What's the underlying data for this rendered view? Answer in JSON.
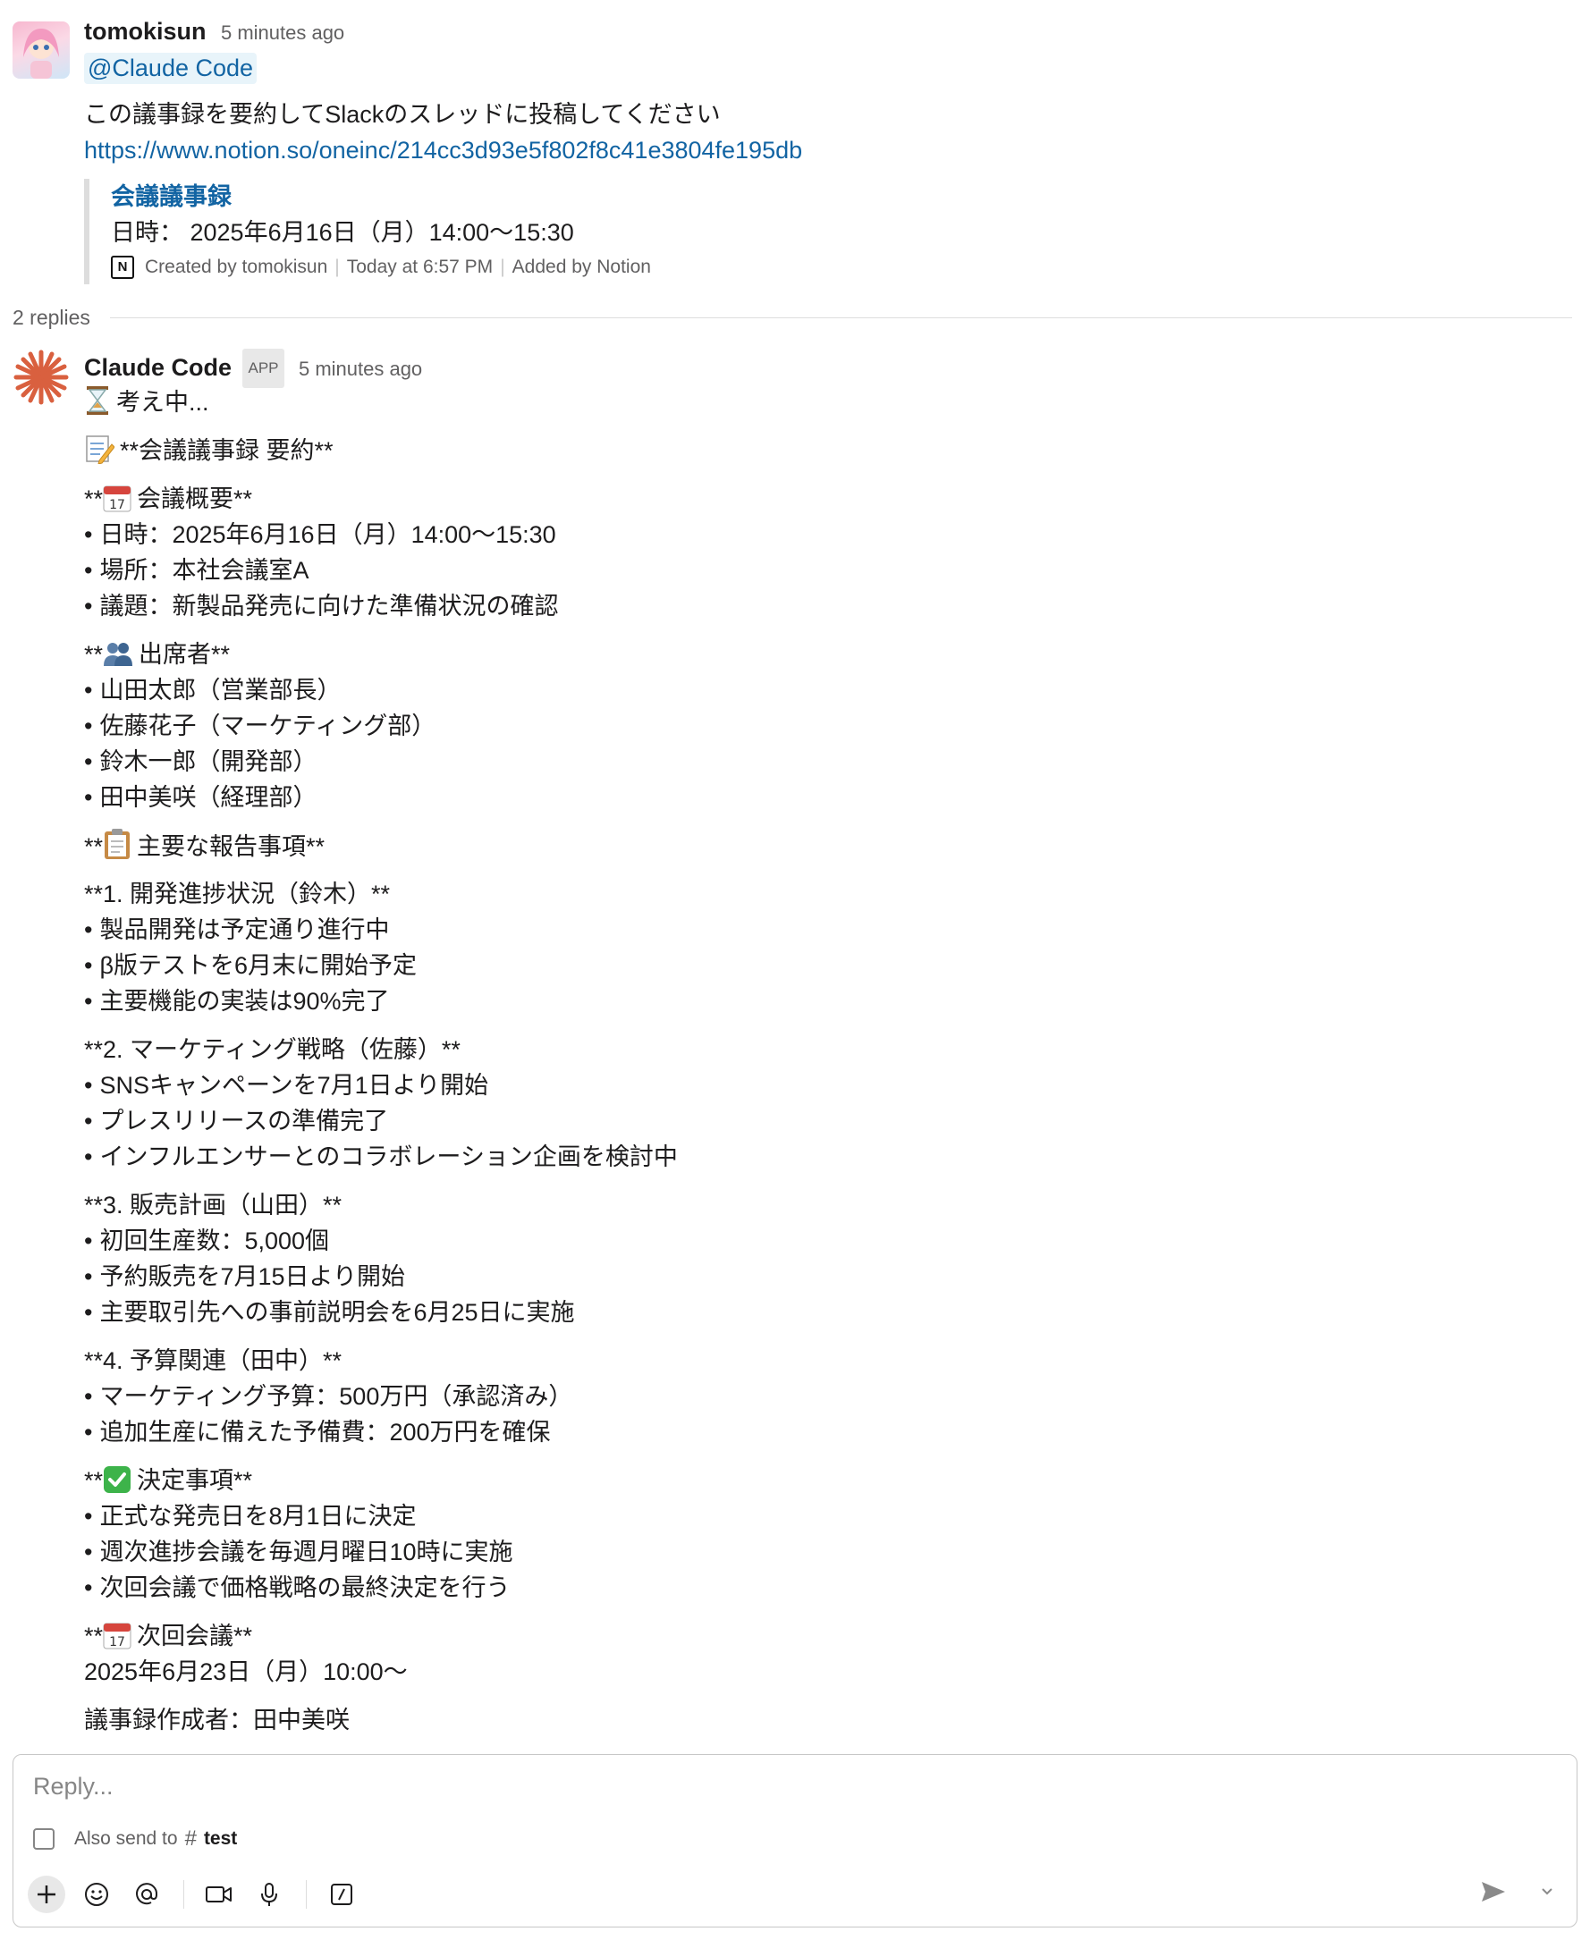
{
  "parent": {
    "author": "tomokisun",
    "time": "5 minutes ago",
    "mention": "@Claude Code",
    "text": "この議事録を要約してSlackのスレッドに投稿してください",
    "link": "https://www.notion.so/oneinc/214cc3d93e5f802f8c41e3804fe195db",
    "unfurl": {
      "title": "会議議事録",
      "desc": "日時： 2025年6月16日（月）14:00〜15:30",
      "created": "Created by tomokisun",
      "when": "Today at 6:57 PM",
      "added": "Added by Notion"
    }
  },
  "replies_label": "2 replies",
  "reply": {
    "author": "Claude Code",
    "badge": "APP",
    "time": "5 minutes ago",
    "thinking": "考え中...",
    "summary_title": "**会議議事録 要約**",
    "overview_heading_pre": "**",
    "overview_heading": "会議概要**",
    "overview": [
      "日時：2025年6月16日（月）14:00〜15:30",
      "場所：本社会議室A",
      "議題：新製品発売に向けた準備状況の確認"
    ],
    "attendees_heading_pre": "**",
    "attendees_heading": "出席者**",
    "attendees": [
      "山田太郎（営業部長）",
      "佐藤花子（マーケティング部）",
      "鈴木一郎（開発部）",
      "田中美咲（経理部）"
    ],
    "reports_heading_pre": "**",
    "reports_heading": "主要な報告事項**",
    "sections": [
      {
        "title": "**1. 開発進捗状況（鈴木）**",
        "items": [
          "製品開発は予定通り進行中",
          "β版テストを6月末に開始予定",
          "主要機能の実装は90%完了"
        ]
      },
      {
        "title": "**2. マーケティング戦略（佐藤）**",
        "items": [
          "SNSキャンペーンを7月1日より開始",
          "プレスリリースの準備完了",
          "インフルエンサーとのコラボレーション企画を検討中"
        ]
      },
      {
        "title": "**3. 販売計画（山田）**",
        "items": [
          "初回生産数：5,000個",
          "予約販売を7月15日より開始",
          "主要取引先への事前説明会を6月25日に実施"
        ]
      },
      {
        "title": "**4. 予算関連（田中）**",
        "items": [
          "マーケティング予算：500万円（承認済み）",
          "追加生産に備えた予備費：200万円を確保"
        ]
      }
    ],
    "decisions_heading_pre": "**",
    "decisions_heading": "決定事項**",
    "decisions": [
      "正式な発売日を8月1日に決定",
      "週次進捗会議を毎週月曜日10時に実施",
      "次回会議で価格戦略の最終決定を行う"
    ],
    "next_heading_pre": "**",
    "next_heading": "次回会議**",
    "next_date": "2025年6月23日（月）10:00〜",
    "author_line": "議事録作成者：田中美咲"
  },
  "composer": {
    "placeholder": "Reply...",
    "also_send": "Also send to",
    "channel": "test"
  },
  "icons": {
    "calendar_day": "17"
  }
}
